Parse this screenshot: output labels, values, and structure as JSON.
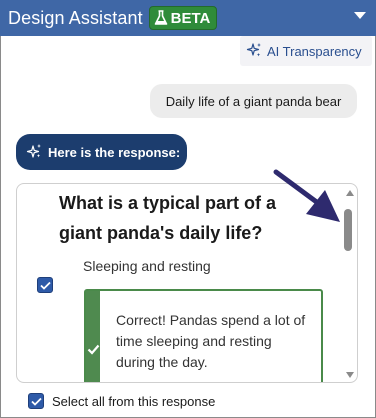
{
  "header": {
    "title": "Design Assistant",
    "badge": "BETA",
    "badge_icon": "flask-icon",
    "colors": {
      "bar": "#3f67a6",
      "badge": "#2f8b3a"
    }
  },
  "ai_transparency": {
    "label": "AI Transparency",
    "icon": "sparkle-icon"
  },
  "chat": {
    "user_message": "Daily life of a giant panda bear",
    "response_label": "Here is the response:"
  },
  "card": {
    "question": "What is a typical part of a giant panda's daily life?",
    "option": {
      "label": "Sleeping and resting",
      "checked": true
    },
    "feedback": {
      "text": "Correct! Pandas spend a lot of time sleeping and resting during the day.",
      "status": "correct",
      "icon": "check-icon"
    }
  },
  "footer": {
    "select_all_label": "Select all from this response",
    "checked": true
  },
  "colors": {
    "accent": "#2e5aa8",
    "dark": "#1c3d6e",
    "correct": "#4f8a4f",
    "annotation_arrow": "#2e2a6e"
  }
}
